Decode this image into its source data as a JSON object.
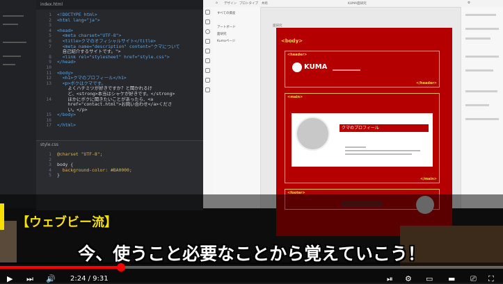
{
  "editor": {
    "tab_label": "index.html",
    "lines": [
      {
        "n": "1",
        "t": "<!DOCTYPE html>"
      },
      {
        "n": "2",
        "t": "<html lang=\"ja\">"
      },
      {
        "n": "3",
        "t": ""
      },
      {
        "n": "4",
        "t": "<head>"
      },
      {
        "n": "5",
        "t": "  <meta charset=\"UTF-8\">"
      },
      {
        "n": "6",
        "t": "  <title>クマのオフィシャルサイト</title>"
      },
      {
        "n": "7",
        "t": "  <meta name=\"description\" content=\"クマについて"
      },
      {
        "n": "",
        "t": "  自己紹介するサイトです。\">"
      },
      {
        "n": "8",
        "t": "  <link rel=\"stylesheet\" href=\"style.css\">"
      },
      {
        "n": "9",
        "t": "</head>"
      },
      {
        "n": "10",
        "t": ""
      },
      {
        "n": "11",
        "t": "<body>"
      },
      {
        "n": "12",
        "t": "  <h1>クマのプロフィール</h1>"
      },
      {
        "n": "13",
        "t": "  <p>ボクはクマです。"
      },
      {
        "n": "",
        "t": "    よくハチミツが好きですか？と聞かれるけ"
      },
      {
        "n": "",
        "t": "    ど、<strong>本当はシャケが好きです。</strong>"
      },
      {
        "n": "14",
        "t": "    ほかにボクに聞きたいことがあったら、<a"
      },
      {
        "n": "",
        "t": "    href=\"contact.html\">お問い合わせ</a>くださ"
      },
      {
        "n": "",
        "t": "    い。</p>"
      },
      {
        "n": "15",
        "t": "</body>"
      },
      {
        "n": "16",
        "t": ""
      },
      {
        "n": "17",
        "t": "</html>"
      }
    ],
    "css_tab": "style.css",
    "css_lines": [
      {
        "n": "1",
        "t": "@charset \"UTF-8\";"
      },
      {
        "n": "2",
        "t": ""
      },
      {
        "n": "3",
        "t": "body {"
      },
      {
        "n": "4",
        "t": "  background-color: #BA0000;"
      },
      {
        "n": "5",
        "t": "}"
      }
    ]
  },
  "xd": {
    "menu": [
      "デザイン",
      "プロトタイプ",
      "共有"
    ],
    "doc_title": "KUMA面研究",
    "layers_search": "すべての資産",
    "layers": [
      "アートボード",
      "面研究",
      "Kumaページ"
    ],
    "artboard_label": "面研究"
  },
  "mockup": {
    "body_label": "<body>",
    "header_label": "<header>",
    "header_close": "</header>",
    "logo_text": "KUMA",
    "main_label": "<main>",
    "main_close": "</main>",
    "profile_title": "クマのプロフィール",
    "footer_label": "<footer>"
  },
  "overlay": {
    "tag": "【ウェブビー流】",
    "subtitle": "今、使うこと必要なことから覚えていこう！"
  },
  "player": {
    "time": "2:24 / 9:31",
    "progress": 0.24
  },
  "colors": {
    "accent_yellow": "#f5e000",
    "artboard_red": "#b50000",
    "progress_red": "#ff0000"
  }
}
